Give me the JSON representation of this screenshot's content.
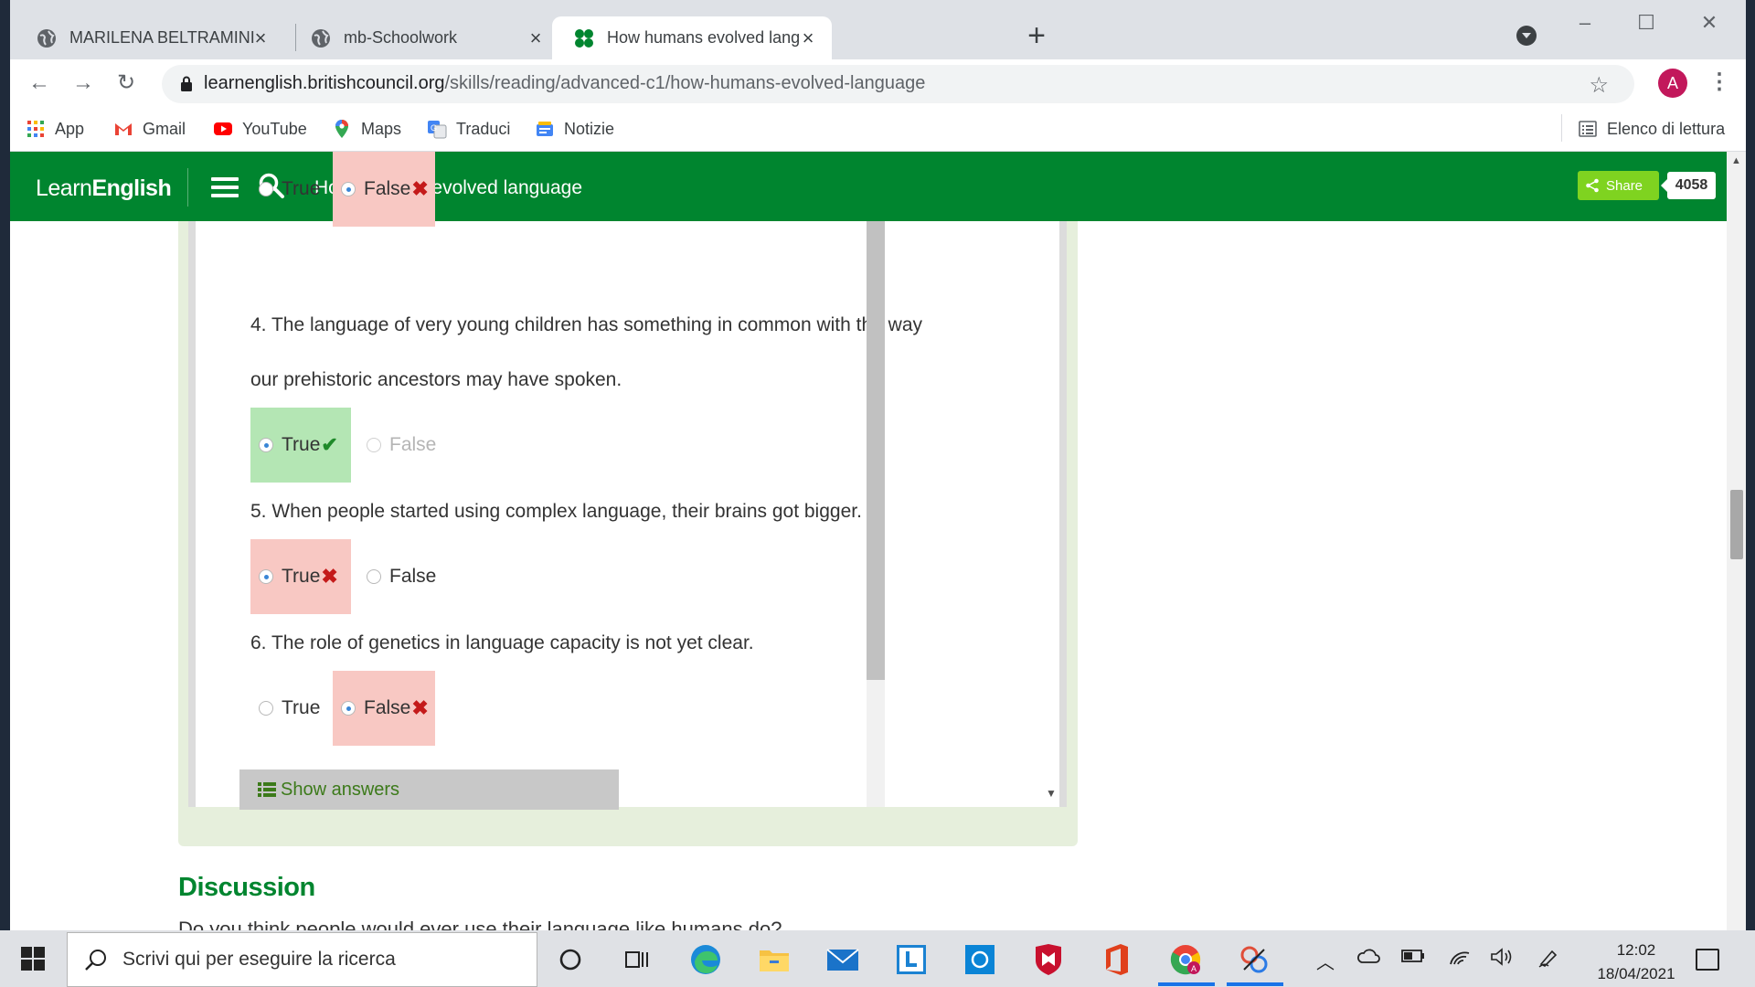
{
  "browser": {
    "tabs": [
      {
        "title": "MARILENA BELTRAMINI",
        "icon": "globe-icon"
      },
      {
        "title": "mb-Schoolwork",
        "icon": "globe-icon"
      },
      {
        "title": "How humans evolved language | ",
        "icon": "learnenglish-icon"
      }
    ],
    "url_host": "learnenglish.britishcouncil.org",
    "url_path": "/skills/reading/advanced-c1/how-humans-evolved-language",
    "profile_initial": "A",
    "bookmarks": [
      "App",
      "Gmail",
      "YouTube",
      "Maps",
      "Traduci",
      "Notizie"
    ],
    "reading_list": "Elenco di lettura"
  },
  "header": {
    "logo_light": "Learn",
    "logo_bold": "English",
    "title": "How humans evolved language",
    "share_label": "Share",
    "share_count": "4058",
    "brand_color": "#00852f"
  },
  "exercise": {
    "questions": [
      {
        "text_lines": [],
        "options": [
          {
            "label": "True",
            "selected": false,
            "result": "none"
          },
          {
            "label": "False",
            "selected": true,
            "result": "wrong"
          }
        ]
      },
      {
        "text_lines": [
          "4. The language of very young children has something in common with the way",
          "our prehistoric ancestors may have spoken."
        ],
        "options": [
          {
            "label": "True",
            "selected": true,
            "result": "correct"
          },
          {
            "label": "False",
            "selected": false,
            "result": "disabled"
          }
        ]
      },
      {
        "text_lines": [
          "5. When people started using complex language, their brains got bigger."
        ],
        "options": [
          {
            "label": "True",
            "selected": true,
            "result": "wrong"
          },
          {
            "label": "False",
            "selected": false,
            "result": "none"
          }
        ]
      },
      {
        "text_lines": [
          "6. The role of genetics in language capacity is not yet clear."
        ],
        "options": [
          {
            "label": "True",
            "selected": false,
            "result": "none"
          },
          {
            "label": "False",
            "selected": true,
            "result": "wrong"
          }
        ]
      }
    ],
    "show_answers_label": "Show answers"
  },
  "discussion": {
    "heading": "Discussion",
    "partial_text": "Do you think people would ever use their language like humans do?"
  },
  "taskbar": {
    "search_placeholder": "Scrivi qui per eseguire la ricerca",
    "time": "12:02",
    "date": "18/04/2021"
  }
}
